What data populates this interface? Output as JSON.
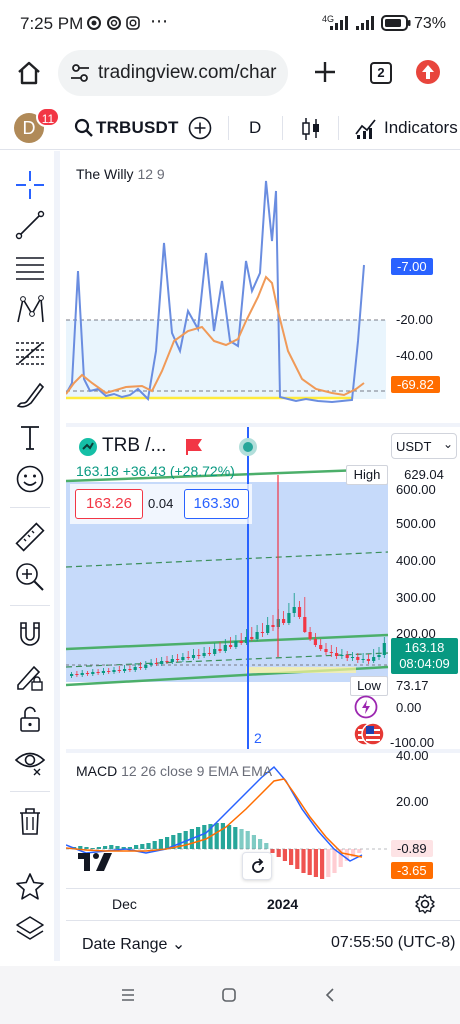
{
  "status_bar": {
    "time": "7:25 PM",
    "network": "4G",
    "battery": "73%"
  },
  "browser": {
    "url": "tradingview.com/char",
    "tab_count": "2"
  },
  "tv_header": {
    "avatar_letter": "D",
    "notification_count": "11",
    "symbol": "TRBUSDT",
    "interval": "D",
    "indicators_label": "Indicators"
  },
  "willy": {
    "title": "The Willy",
    "params": "12 9",
    "levels": [
      "-20.00",
      "-40.00"
    ],
    "value_blue": "-7.00",
    "value_orange": "-69.82",
    "colors": {
      "blue": "#2962ff",
      "orange": "#ff6d00"
    }
  },
  "main_chart": {
    "symbol_short": "TRB /...",
    "currency": "USDT",
    "last": "163.18",
    "change": "+36.43 (+28.72%)",
    "bid": "163.26",
    "spread": "0.04",
    "ask": "163.30",
    "high_label": "High",
    "high_value": "629.04",
    "low_label": "Low",
    "low_value": "73.17",
    "price_tag": "163.18",
    "countdown": "08:04:09",
    "axis_ticks": [
      "600.00",
      "500.00",
      "400.00",
      "300.00",
      "200.00"
    ],
    "zero_label": "0.00",
    "neg_label": "-100.00",
    "marker_label": "2",
    "colors": {
      "up": "#089981",
      "down": "#f23645"
    }
  },
  "macd": {
    "title": "MACD",
    "params": "12 26 close 9 EMA EMA",
    "axis_ticks": [
      "40.00",
      "20.00"
    ],
    "value_macd": "-0.89",
    "value_signal": "-3.65"
  },
  "time_axis": {
    "labels": [
      "Dec",
      "2024"
    ]
  },
  "bottom": {
    "date_range": "Date Range",
    "time": "07:55:50 (UTC-8)"
  }
}
